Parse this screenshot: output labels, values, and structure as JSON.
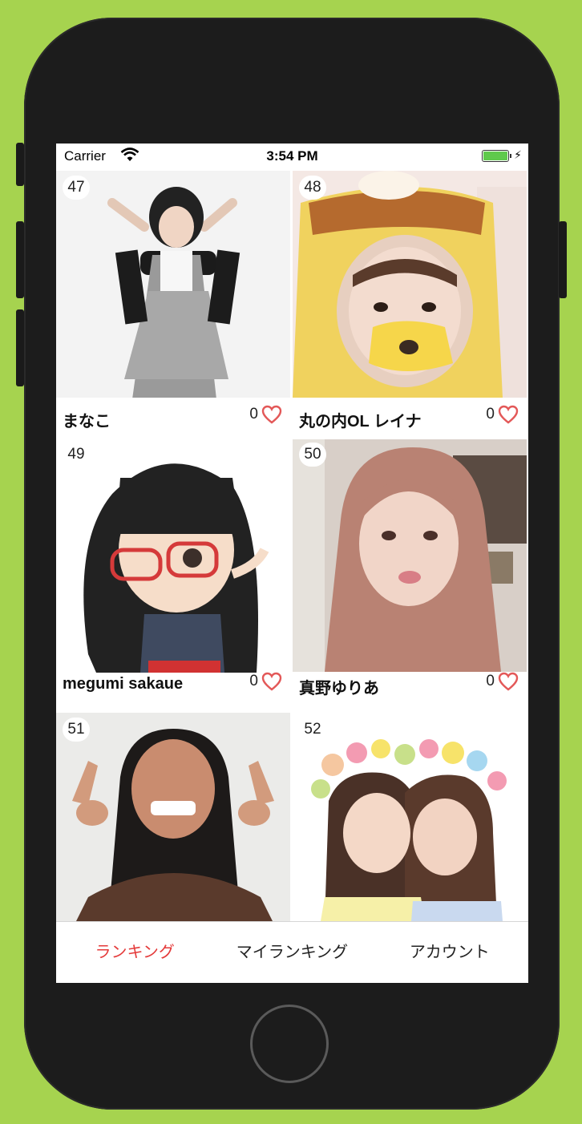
{
  "status_bar": {
    "carrier": "Carrier",
    "time": "3:54 PM",
    "bolt": "⚡"
  },
  "cards": [
    {
      "rank": "47",
      "name": "まなこ",
      "likes": "0"
    },
    {
      "rank": "48",
      "name": "丸の内OL レイナ",
      "likes": "0"
    },
    {
      "rank": "49",
      "name": "megumi sakaue",
      "likes": "0"
    },
    {
      "rank": "50",
      "name": "真野ゆりあ",
      "likes": "0"
    },
    {
      "rank": "51",
      "name": "",
      "likes": ""
    },
    {
      "rank": "52",
      "name": "",
      "likes": ""
    }
  ],
  "tabs": [
    {
      "label": "ランキング",
      "active": true
    },
    {
      "label": "マイランキング",
      "active": false
    },
    {
      "label": "アカウント",
      "active": false
    }
  ],
  "colors": {
    "background": "#a6d34f",
    "device": "#1c1c1c",
    "active_tab": "#e43a3a",
    "heart": "#e35858",
    "battery": "#5fc94c"
  }
}
